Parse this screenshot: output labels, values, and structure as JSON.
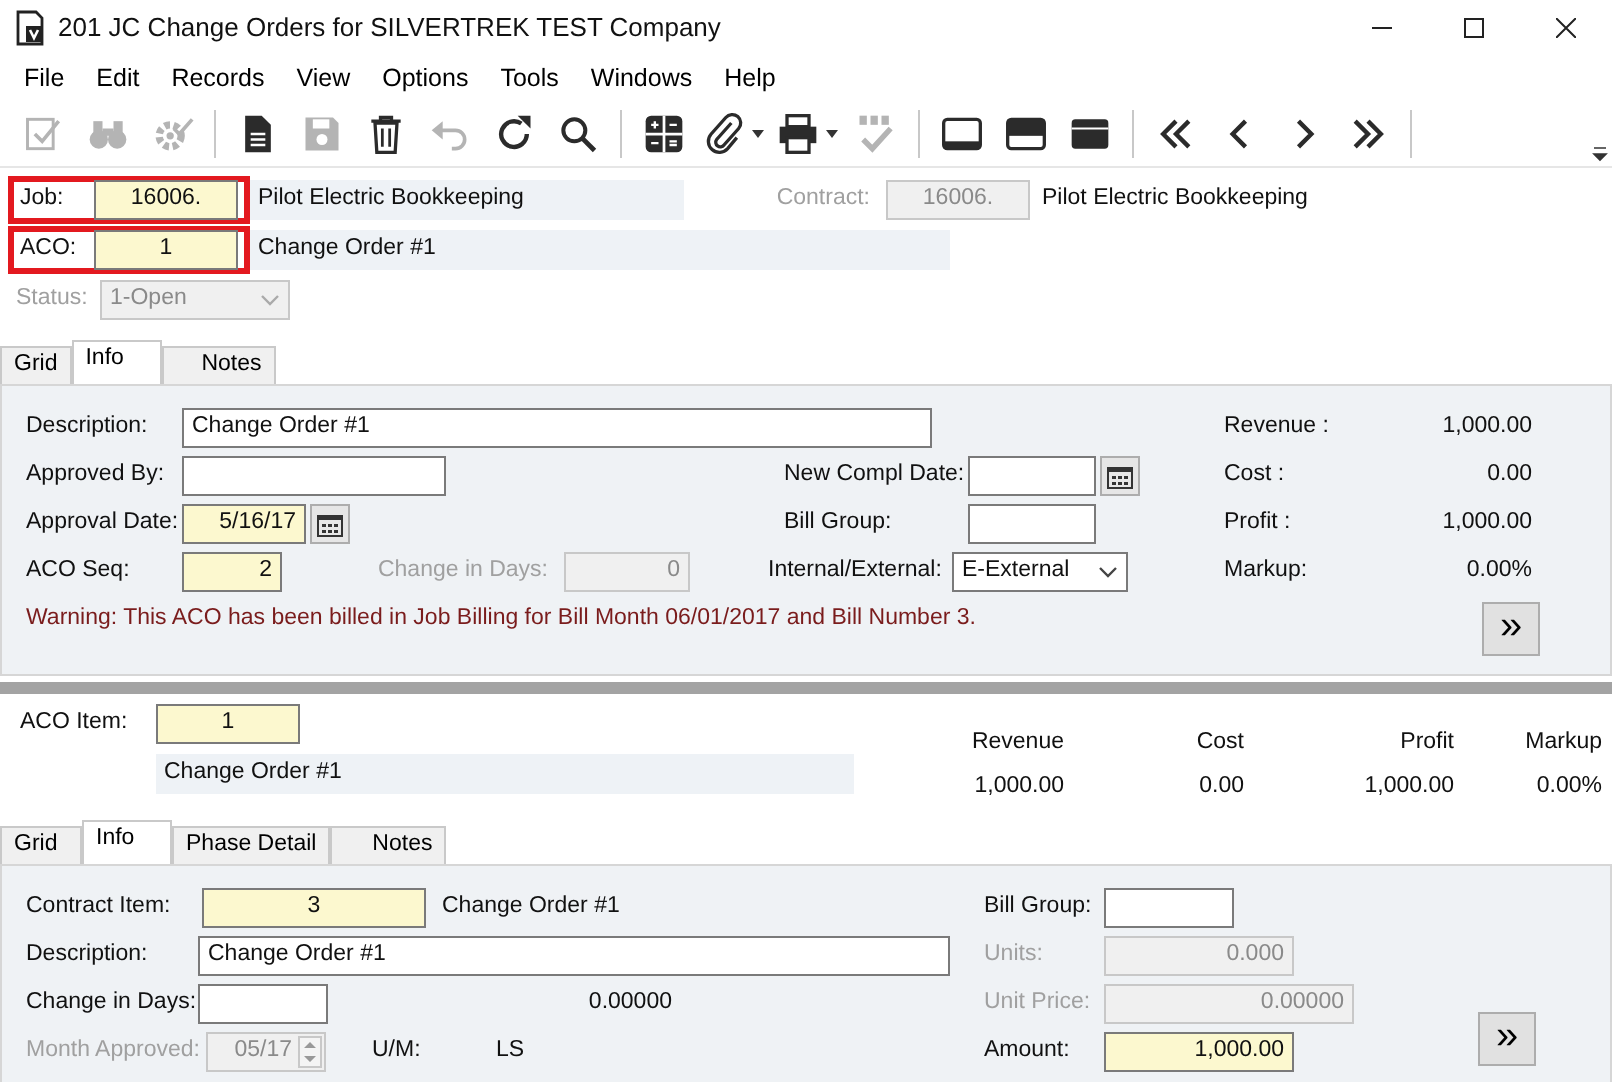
{
  "window": {
    "title": "201 JC Change Orders for SILVERTREK TEST Company"
  },
  "menu": [
    "File",
    "Edit",
    "Records",
    "View",
    "Options",
    "Tools",
    "Windows",
    "Help"
  ],
  "toolbar": [
    {
      "disabled": true
    },
    {
      "disabled": true
    },
    {
      "disabled": true
    },
    {
      "disabled": false
    },
    {
      "disabled": true
    },
    {
      "disabled": false
    },
    {
      "disabled": true
    },
    {
      "disabled": false
    },
    {
      "disabled": false
    },
    {
      "disabled": false
    },
    {
      "disabled": false
    },
    {
      "disabled": false
    },
    {
      "disabled": true
    },
    {
      "disabled": false
    },
    {
      "disabled": false
    },
    {
      "disabled": false
    },
    {
      "disabled": false
    },
    {
      "disabled": false
    },
    {
      "disabled": false
    },
    {
      "disabled": false
    }
  ],
  "header": {
    "job": {
      "label": "Job:",
      "value": "16006.",
      "description": "Pilot Electric Bookkeeping",
      "required": true,
      "disabled": false,
      "highlighted": true
    },
    "contract": {
      "label": "Contract:",
      "value": "16006.",
      "description": "Pilot Electric Bookkeeping",
      "disabled": true
    },
    "aco": {
      "label": "ACO:",
      "value": "1",
      "description": "Change Order #1",
      "required": true,
      "disabled": false,
      "highlighted": true
    },
    "status": {
      "label": "Status:",
      "value": "1-Open",
      "disabled": true
    }
  },
  "tabs": [
    {
      "label": "Grid",
      "selected": false
    },
    {
      "label": "Info",
      "selected": true
    },
    {
      "label": "Notes",
      "selected": false
    }
  ],
  "info": {
    "description": {
      "label": "Description:",
      "value": "Change Order #1",
      "required": false,
      "disabled": false
    },
    "approved_by": {
      "label": "Approved By:",
      "required": false,
      "disabled": false
    },
    "new_compl_date": {
      "label": "New Compl Date:",
      "required": false,
      "disabled": false
    },
    "approval_date": {
      "label": "Approval Date:",
      "value": "5/16/17",
      "required": true,
      "disabled": false
    },
    "bill_group": {
      "label": "Bill Group:",
      "required": false,
      "disabled": false
    },
    "aco_seq": {
      "label": "ACO Seq:",
      "value": "2",
      "required": true,
      "disabled": false
    },
    "change_in_days": {
      "label": "Change in Days:",
      "value": "0",
      "disabled": true
    },
    "internal_external": {
      "label": "Internal/External:",
      "value": "E-External",
      "required": false,
      "disabled": false
    },
    "warning": "Warning: This ACO has been billed in Job Billing for Bill Month 06/01/2017 and Bill Number 3.",
    "summary": [
      {
        "label": "Revenue :",
        "value": "1,000.00"
      },
      {
        "label": "Cost :",
        "value": "0.00"
      },
      {
        "label": "Profit :",
        "value": "1,000.00"
      },
      {
        "label": "Markup:",
        "value": "0.00%"
      }
    ],
    "more_button": "»"
  },
  "aco_item": {
    "label": "ACO Item:",
    "value": "1",
    "description": "Change Order #1",
    "required": true,
    "disabled": false,
    "totals": [
      {
        "label": "Revenue",
        "value": "1,000.00"
      },
      {
        "label": "Cost",
        "value": "0.00"
      },
      {
        "label": "Profit",
        "value": "1,000.00"
      },
      {
        "label": "Markup",
        "value": "0.00%"
      }
    ]
  },
  "item_tabs": [
    {
      "label": "Grid",
      "selected": false
    },
    {
      "label": "Info",
      "selected": true
    },
    {
      "label": "Phase Detail",
      "selected": false
    },
    {
      "label": "Notes",
      "selected": false
    }
  ],
  "item_info": {
    "contract_item": {
      "label": "Contract Item:",
      "value": "3",
      "description": "Change Order #1",
      "required": true,
      "disabled": false
    },
    "bill_group": {
      "label": "Bill Group:",
      "required": false,
      "disabled": false
    },
    "description": {
      "label": "Description:",
      "value": "Change Order #1",
      "required": false,
      "disabled": false
    },
    "units": {
      "label": "Units:",
      "value": "0.000",
      "disabled": true
    },
    "change_in_days": {
      "label": "Change in Days:",
      "required": false,
      "disabled": false
    },
    "factor": "0.00000",
    "unit_price": {
      "label": "Unit Price:",
      "value": "0.00000",
      "disabled": true
    },
    "month_approved": {
      "label": "Month Approved:",
      "value": "05/17",
      "disabled": true
    },
    "um": {
      "label": "U/M:",
      "value": "LS"
    },
    "amount": {
      "label": "Amount:",
      "value": "1,000.00",
      "required": true,
      "disabled": false
    },
    "more_button": "»"
  }
}
